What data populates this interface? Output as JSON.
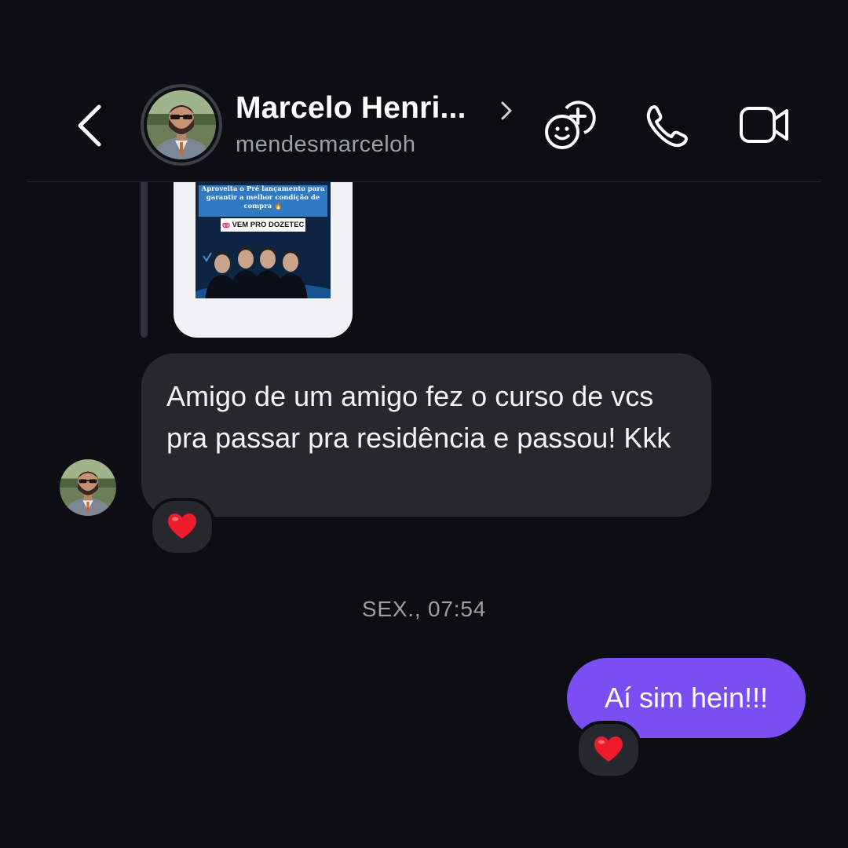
{
  "header": {
    "contact_name": "Marcelo Henri...",
    "username": "mendesmarceloh"
  },
  "story": {
    "banner_text": "Aproveita o Pré lançamento para garantir a melhor condição de compra 🔥",
    "button_label": "VEM PRO DOZETEC"
  },
  "messages": [
    {
      "sender": "contact",
      "text": "Amigo de um amigo fez o curso de vcs pra passar pra residência e passou! Kkk",
      "reaction": "❤️"
    },
    {
      "sender": "me",
      "text": "Aí sim hein!!!",
      "reaction": "❤️"
    }
  ],
  "timestamp": "SEX., 07:54",
  "colors": {
    "background": "#0c0e13",
    "incoming_bubble": "#26282e",
    "outgoing_bubble": "#7a4ef2",
    "secondary_text": "#9aa0a8"
  },
  "icons": [
    "back-icon",
    "chevron-right-icon",
    "add-people-icon",
    "phone-icon",
    "video-camera-icon",
    "heart-icon",
    "link-icon"
  ]
}
